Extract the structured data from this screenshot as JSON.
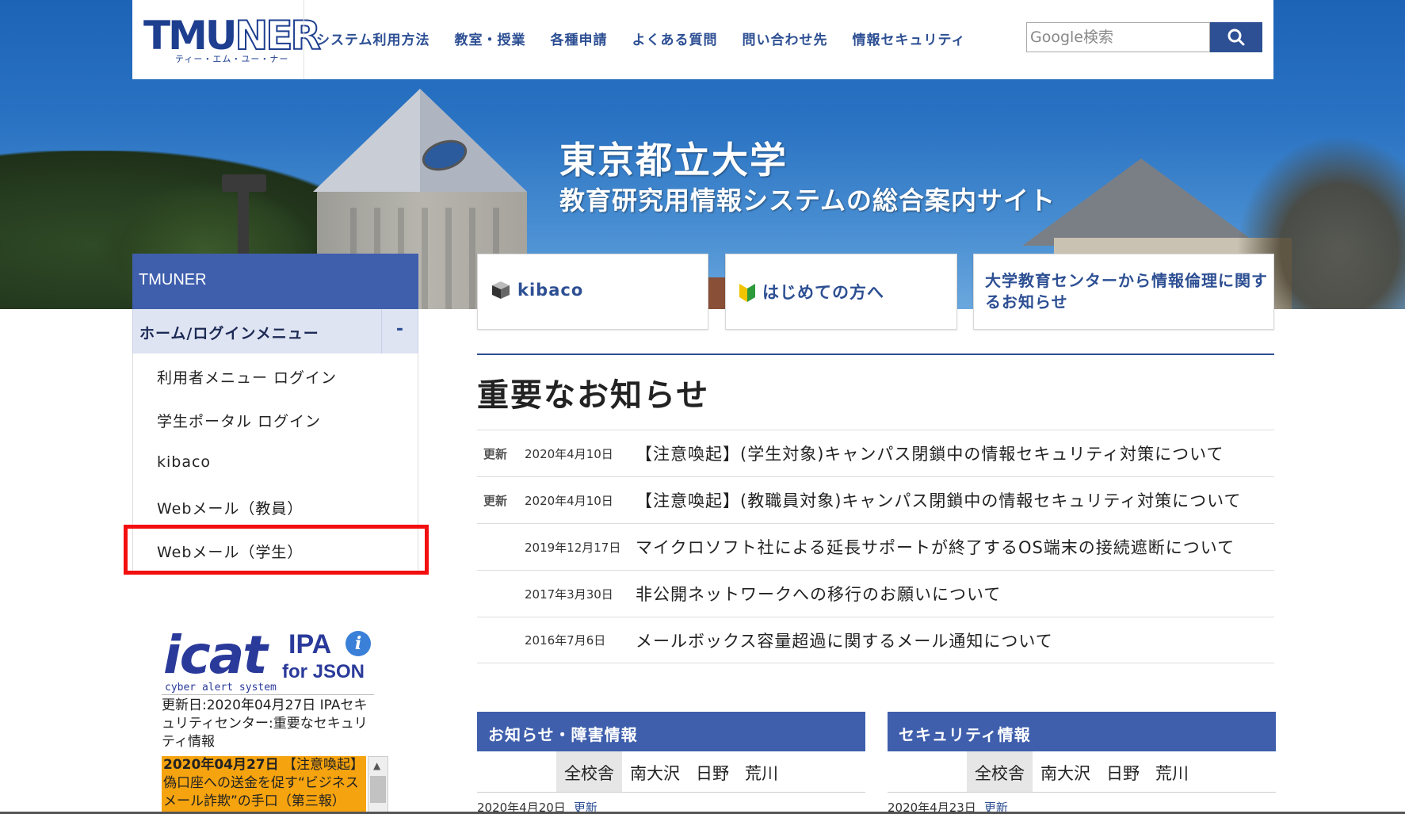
{
  "header": {
    "logo_text": "TMUNER",
    "logo_kana": "ティー・エム・ユー・ナー",
    "nav": [
      "システム利用方法",
      "教室・授業",
      "各種申請",
      "よくある質問",
      "問い合わせ先",
      "情報セキュリティ"
    ],
    "search_placeholder": "Google検索"
  },
  "hero": {
    "title": "東京都立大学",
    "subtitle": "教育研究用情報システムの総合案内サイト"
  },
  "sidebar": {
    "title": "TMUNER",
    "home_label": "ホーム/ログインメニュー",
    "toggle": "-",
    "items": [
      {
        "label": "利用者メニュー ログイン"
      },
      {
        "label": "学生ポータル ログイン"
      },
      {
        "label": "kibaco"
      },
      {
        "label": "Webメール（教員）"
      },
      {
        "label": "Webメール（学生）"
      }
    ]
  },
  "icat": {
    "logo_main": "icat",
    "logo_ipa": "IPA",
    "logo_json": "for JSON",
    "logo_tag": "cyber alert system",
    "meta": "更新日:2020年04月27日 IPAセキュリティセンター:重要なセキュリティ情報",
    "alert_date": "2020年04月27日",
    "alert_text": "【注意喚起】偽口座への送金を促す“ビジネスメール詐欺”の手口（第三報）"
  },
  "cards": [
    {
      "label": "kibaco"
    },
    {
      "label": "はじめての方へ"
    },
    {
      "label": "大学教育センターから情報倫理に関するお知らせ"
    }
  ],
  "notices": {
    "title": "重要なお知らせ",
    "items": [
      {
        "tag": "更新",
        "date": "2020年4月10日",
        "text": "【注意喚起】(学生対象)キャンパス閉鎖中の情報セキュリティ対策について"
      },
      {
        "tag": "更新",
        "date": "2020年4月10日",
        "text": "【注意喚起】(教職員対象)キャンパス閉鎖中の情報セキュリティ対策について"
      },
      {
        "tag": "",
        "date": "2019年12月17日",
        "text": "マイクロソフト社による延長サポートが終了するOS端末の接続遮断について"
      },
      {
        "tag": "",
        "date": "2017年3月30日",
        "text": "非公開ネットワークへの移行のお願いについて"
      },
      {
        "tag": "",
        "date": "2016年7月6日",
        "text": "メールボックス容量超過に関するメール通知について"
      }
    ]
  },
  "panels": [
    {
      "title": "お知らせ・障害情報",
      "tabs": [
        "全校舎",
        "南大沢",
        "日野",
        "荒川"
      ],
      "date": "2020年4月20日",
      "tag": "更新"
    },
    {
      "title": "セキュリティ情報",
      "tabs": [
        "全校舎",
        "南大沢",
        "日野",
        "荒川"
      ],
      "date": "2020年4月23日",
      "tag": "更新"
    }
  ],
  "colors": {
    "brand": "#2d4f93",
    "sidebar_head": "#3f5fad",
    "highlight": "#f30f0f",
    "alert_bg": "#f5a30f"
  }
}
